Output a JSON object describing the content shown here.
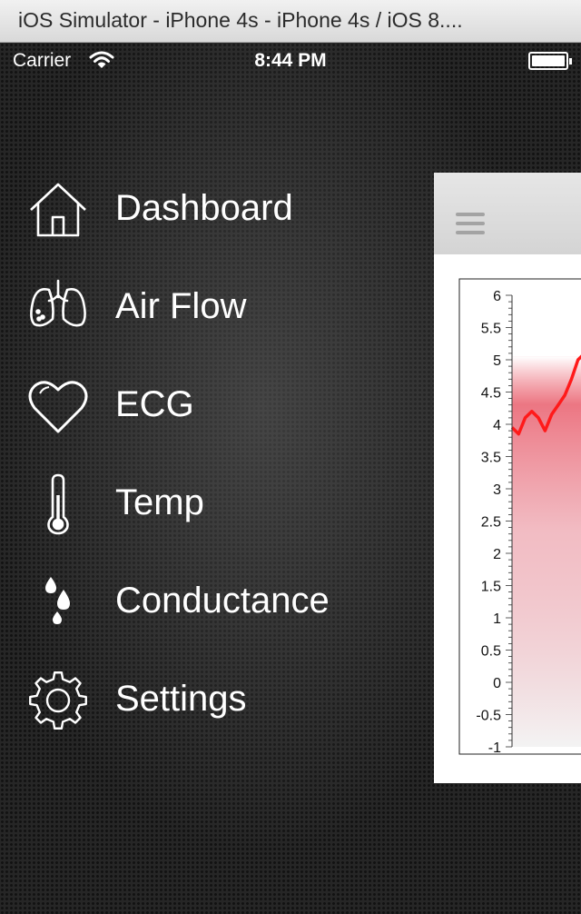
{
  "window": {
    "title": "iOS Simulator - iPhone 4s - iPhone 4s / iOS 8...."
  },
  "statusbar": {
    "carrier": "Carrier",
    "time": "8:44 PM",
    "wifi_icon": "wifi-icon",
    "battery_icon": "battery-icon"
  },
  "menu": {
    "items": [
      {
        "label": "Dashboard",
        "icon": "home-icon"
      },
      {
        "label": "Air Flow",
        "icon": "lungs-icon"
      },
      {
        "label": "ECG",
        "icon": "heart-icon"
      },
      {
        "label": "Temp",
        "icon": "thermometer-icon"
      },
      {
        "label": "Conductance",
        "icon": "droplets-icon"
      },
      {
        "label": "Settings",
        "icon": "gear-icon"
      }
    ]
  },
  "panel": {
    "menu_icon": "hamburger-icon"
  },
  "chart_data": {
    "type": "area",
    "title": "",
    "xlabel": "",
    "ylabel": "",
    "ylim": [
      -1,
      6
    ],
    "y_ticks": [
      "6",
      "5.5",
      "5",
      "4.5",
      "4",
      "3.5",
      "3",
      "2.5",
      "2",
      "1.5",
      "1",
      "0.5",
      "0",
      "-0.5",
      "-1"
    ],
    "series": [
      {
        "values": [
          3.95,
          3.85,
          4.1,
          4.2,
          4.1,
          3.9,
          4.15,
          4.3,
          4.45,
          4.7,
          5.0,
          5.1
        ],
        "color": "#ff1a1a"
      }
    ],
    "grid": false
  }
}
